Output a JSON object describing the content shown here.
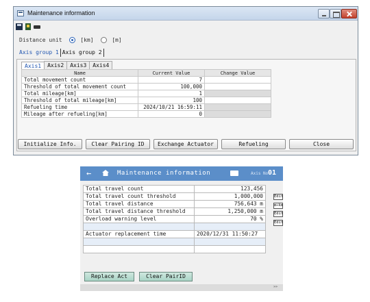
{
  "window": {
    "title": "Maintenance information"
  },
  "unit": {
    "label": "Distance unit",
    "options": [
      "[km]",
      "[m]"
    ],
    "selected": "[km]"
  },
  "group_tabs": [
    "Axis group 1",
    "Axis group 2"
  ],
  "axis_tabs": [
    "Axis1",
    "Axis2",
    "Axis3",
    "Axis4"
  ],
  "grid": {
    "headers": [
      "Name",
      "Current Value",
      "Change Value"
    ],
    "rows": [
      {
        "name": "Total movement count",
        "current": "7",
        "change": ""
      },
      {
        "name": "Threshold of total movement count",
        "current": "100,000",
        "change": ""
      },
      {
        "name": "Total mileage[km]",
        "current": "1",
        "change": ""
      },
      {
        "name": "Threshold of total mileage[km]",
        "current": "100",
        "change": ""
      },
      {
        "name": "Refueling time",
        "current": "2024/10/21 16:59:11",
        "change": ""
      },
      {
        "name": "Mileage after refueling[km]",
        "current": "0",
        "change": ""
      }
    ]
  },
  "buttons": {
    "initialize": "Initialize Info.",
    "clear_pairing": "Clear Pairing ID",
    "exchange": "Exchange Actuator",
    "refueling": "Refueling",
    "close": "Close"
  },
  "panel": {
    "title": "Maintenance information",
    "axis_label": "Axis No.",
    "axis_no": "01",
    "rows": [
      {
        "name": "Total travel count",
        "value": "123,456",
        "edit": ""
      },
      {
        "name": "Total travel count threshold",
        "value": "1,000,000",
        "edit": "Edit"
      },
      {
        "name": "Total travel distance",
        "value": "756,643 m",
        "edit": "m⇔km"
      },
      {
        "name": "Total travel distance threshold",
        "value": "1,250,000 m",
        "edit": "Edit"
      },
      {
        "name": "Overload warning level",
        "value": "70 %",
        "edit": "Edit"
      },
      {
        "name": "",
        "value": "",
        "edit": ""
      },
      {
        "name": "Actuator replacement time",
        "value": "2020/12/31 11:50:27",
        "edit": ""
      },
      {
        "name": "",
        "value": "",
        "edit": ""
      },
      {
        "name": "",
        "value": "",
        "edit": ""
      }
    ],
    "replace_button": "Replace Act",
    "clear_button": "Clear PairID",
    "footer": "»»"
  }
}
